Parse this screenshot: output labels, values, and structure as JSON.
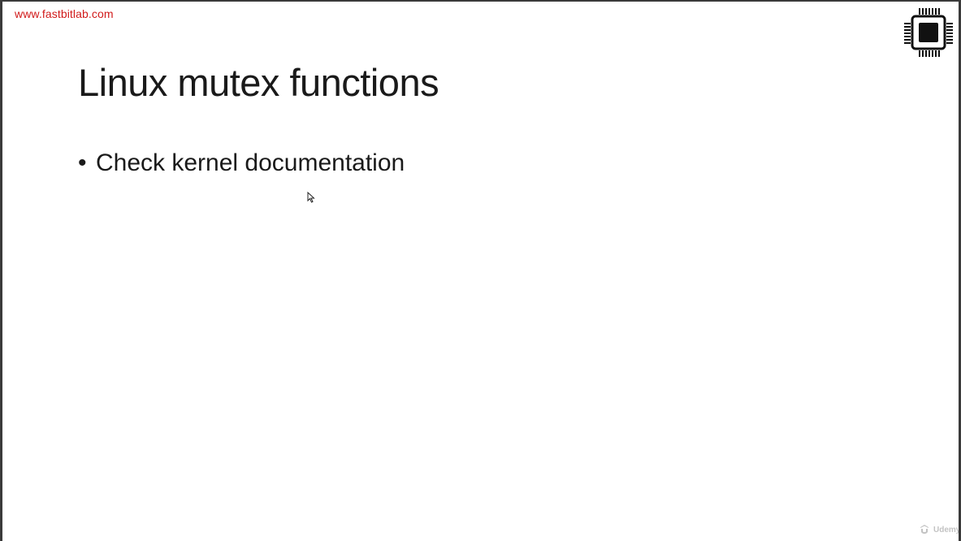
{
  "header": {
    "site_url": "www.fastbitlab.com",
    "logo_icon": "chip-icon"
  },
  "slide": {
    "title": "Linux mutex functions",
    "bullets": [
      {
        "text": "Check kernel documentation",
        "symbol": "•"
      }
    ]
  },
  "overlay": {
    "cursor_icon": "mouse-cursor-icon",
    "watermark_text": "Udemy",
    "watermark_icon": "udemy-logo-icon"
  },
  "colors": {
    "url_red": "#d11a1a",
    "text": "#1a1a1a",
    "border": "#3a3a3a",
    "background": "#ffffff"
  }
}
